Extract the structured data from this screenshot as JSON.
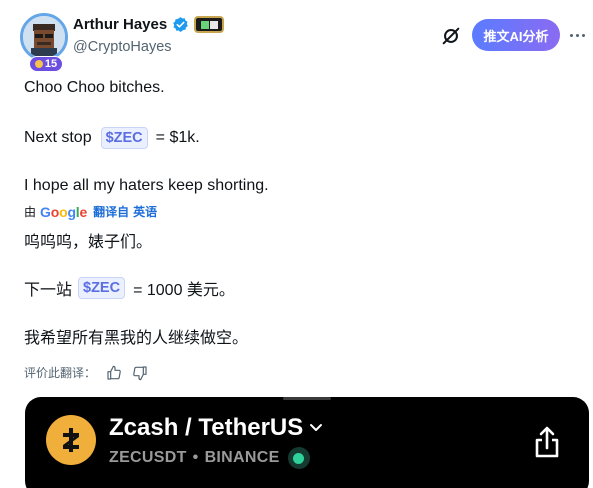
{
  "author": {
    "display_name": "Arthur Hayes",
    "handle": "@CryptoHayes",
    "level": "15"
  },
  "actions": {
    "ai_button_label": "推文AI分析"
  },
  "tweet": {
    "original": {
      "line1": "Choo Choo bitches.",
      "line2_prefix": "Next stop",
      "line2_cashtag": "$ZEC",
      "line2_suffix": "= $1k.",
      "line3": "I hope all my haters keep shorting."
    },
    "translation_bar": {
      "by": "由",
      "google_letters": [
        "G",
        "o",
        "o",
        "g",
        "l",
        "e"
      ],
      "translated_from": "翻译自",
      "language": "英语"
    },
    "translated": {
      "line1": "呜呜呜，婊子们。",
      "line2_prefix": "下一站",
      "line2_cashtag": "$ZEC",
      "line2_suffix": "= 1000 美元。",
      "line3": "我希望所有黑我的人继续做空。"
    },
    "rate_label": "评价此翻译："
  },
  "card": {
    "pair": "Zcash / TetherUS",
    "symbol": "ZECUSDT",
    "separator": "•",
    "exchange": "BINANCE"
  },
  "colors": {
    "cashtag_text": "#5b6ee1",
    "cashtag_bg": "#eaf0ff",
    "ai_gradient_start": "#5b7cff",
    "ai_gradient_end": "#8a6bf2",
    "zcash_brand": "#f0ae3a",
    "live_green": "#2fd19a"
  }
}
